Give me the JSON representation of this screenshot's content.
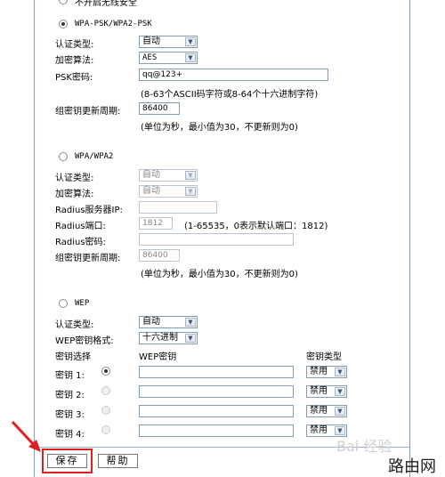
{
  "top": {
    "no_security_label": "不开启无线安全"
  },
  "wpa_psk": {
    "section_label": "WPA-PSK/WPA2-PSK",
    "auth_type_label": "认证类型:",
    "auth_type_value": "自动",
    "encryption_label": "加密算法:",
    "encryption_value": "AES",
    "psk_label": "PSK密码:",
    "psk_value": "qq@123+",
    "psk_hint": "(8-63个ASCII码字符或8-64个十六进制字符)",
    "group_key_label": "组密钥更新周期:",
    "group_key_value": "86400",
    "group_key_hint": "(单位为秒，最小值为30，不更新则为0)"
  },
  "wpa": {
    "section_label": "WPA/WPA2",
    "auth_type_label": "认证类型:",
    "auth_type_value": "自动",
    "encryption_label": "加密算法:",
    "encryption_value": "自动",
    "radius_ip_label": "Radius服务器IP:",
    "radius_ip_value": "",
    "radius_port_label": "Radius端口:",
    "radius_port_value": "1812",
    "radius_port_hint": "(1-65535，0表示默认端口：1812)",
    "radius_pwd_label": "Radius密码:",
    "radius_pwd_value": "",
    "group_key_label": "组密钥更新周期:",
    "group_key_value": "86400",
    "group_key_hint": "(单位为秒，最小值为30，不更新则为0)"
  },
  "wep": {
    "section_label": "WEP",
    "auth_type_label": "认证类型:",
    "auth_type_value": "自动",
    "key_format_label": "WEP密钥格式:",
    "key_format_value": "十六进制",
    "col_select": "密钥选择",
    "col_key": "WEP密钥",
    "col_type": "密钥类型",
    "keys": [
      {
        "label": "密钥 1:",
        "type": "禁用"
      },
      {
        "label": "密钥 2:",
        "type": "禁用"
      },
      {
        "label": "密钥 3:",
        "type": "禁用"
      },
      {
        "label": "密钥 4:",
        "type": "禁用"
      }
    ]
  },
  "buttons": {
    "save": "保存",
    "help": "帮助"
  },
  "watermark": {
    "baidu": "Bai 经验",
    "site": "路由网"
  },
  "colors": {
    "highlight": "#e02020",
    "border": "#7f9db9"
  }
}
